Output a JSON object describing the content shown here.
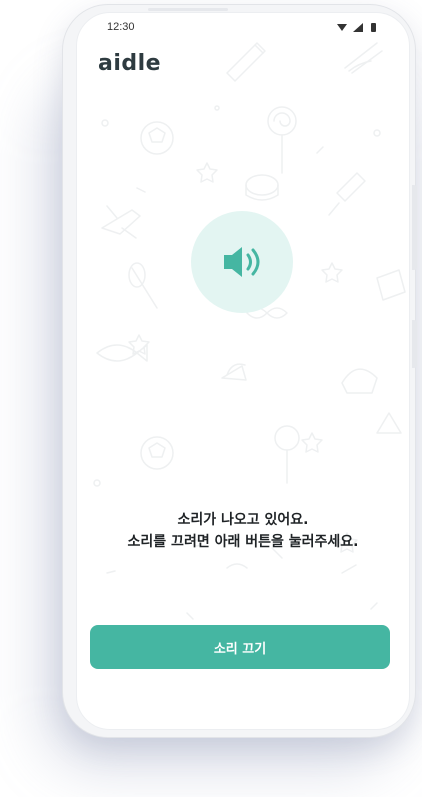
{
  "status_bar": {
    "time": "12:30"
  },
  "app": {
    "logo": "aidle"
  },
  "speaker": {
    "icon": "speaker-volume-icon",
    "accent_color": "#45b6a2",
    "circle_color": "#e3f5f2"
  },
  "message": {
    "line1": "소리가 나오고 있어요.",
    "line2": "소리를 끄려면 아래 버튼을 눌러주세요."
  },
  "actions": {
    "mute_label": "소리 끄기"
  }
}
